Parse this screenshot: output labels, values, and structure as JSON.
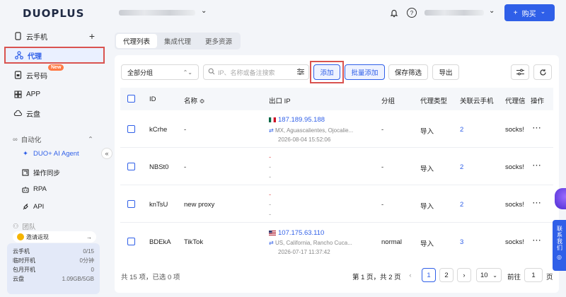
{
  "brand": {
    "logo": "DUOPLUS"
  },
  "sidebar": {
    "items": [
      {
        "label": "云手机",
        "icon": "phone-icon"
      },
      {
        "label": "代理",
        "icon": "proxy-icon"
      },
      {
        "label": "云号码",
        "icon": "sim-icon",
        "badge": "New"
      },
      {
        "label": "APP",
        "icon": "grid-icon"
      },
      {
        "label": "云盘",
        "icon": "cloud-icon"
      }
    ],
    "automation": {
      "label": "自动化",
      "items": [
        {
          "label": "DUO+ AI Agent"
        },
        {
          "label": "操作同步"
        },
        {
          "label": "RPA"
        },
        {
          "label": "API"
        }
      ]
    },
    "team_label": "团队",
    "invite_label": "邀请返现",
    "invite_arrow": "→",
    "quota": [
      {
        "label": "云手机",
        "value": "0/15"
      },
      {
        "label": "临时开机",
        "value": "0分钟"
      },
      {
        "label": "包月开机",
        "value": "0"
      },
      {
        "label": "云盘",
        "value": "1.09GB/5GB"
      }
    ]
  },
  "header": {
    "buy_label": "购买",
    "buy_plus": "+",
    "buy_chev": "⌄"
  },
  "tabs": [
    {
      "label": "代理列表",
      "active": true
    },
    {
      "label": "集成代理",
      "active": false
    },
    {
      "label": "更多资源",
      "active": false
    }
  ],
  "toolbar": {
    "group_select": "全部分组",
    "search_placeholder": "IP、名称或备注搜索",
    "add_label": "添加",
    "batch_add_label": "批量添加",
    "save_filter_label": "保存筛选",
    "export_label": "导出"
  },
  "table": {
    "columns": [
      "ID",
      "名称 ≎",
      "出口 IP",
      "分组",
      "代理类型",
      "关联云手机",
      "代理信",
      "操作"
    ],
    "rows": [
      {
        "id": "kCrhe",
        "name": "-",
        "ip": "187.189.95.188",
        "flag": "mx",
        "location": "MX, Aguascalientes, Ojocalie...",
        "time": "2026-08-04 15:52:06",
        "group": "-",
        "type": "导入",
        "phones": "2",
        "info": "socks!",
        "more": "···"
      },
      {
        "id": "NBSt0",
        "name": "-",
        "ip": "-",
        "flag": "",
        "location": "-",
        "time": "-",
        "group": "-",
        "type": "导入",
        "phones": "2",
        "info": "socks!",
        "more": "···"
      },
      {
        "id": "knTsU",
        "name": "new proxy",
        "ip": "-",
        "flag": "",
        "location": "-",
        "time": "-",
        "group": "-",
        "type": "导入",
        "phones": "2",
        "info": "socks!",
        "more": "···"
      },
      {
        "id": "BDEkA",
        "name": "TikTok",
        "ip": "107.175.63.110",
        "flag": "us",
        "location": "US, California, Rancho Cuca...",
        "time": "2026-07-17 11:37:42",
        "group": "normal",
        "type": "导入",
        "phones": "3",
        "info": "socks!",
        "more": "···"
      }
    ]
  },
  "footer": {
    "summary": "共 15 项，已选 0 项",
    "page_info": "第 1 页，共 2 页",
    "pages": [
      "1",
      "2"
    ],
    "page_size": "10",
    "goto_label": "前往",
    "goto_value": "1",
    "page_suffix": "页"
  },
  "float": {
    "contact_label": "联系我们"
  },
  "colors": {
    "accent": "#2f5fe8",
    "highlight_frame": "#d9534f",
    "badge": "#ff7a45"
  }
}
